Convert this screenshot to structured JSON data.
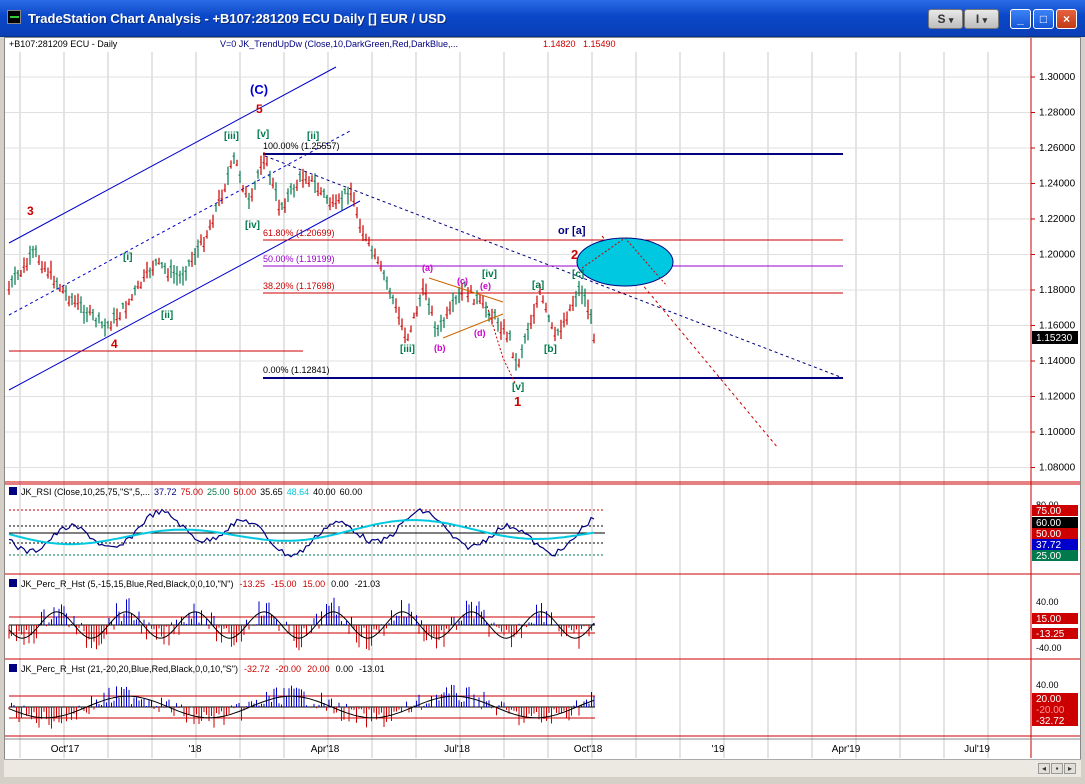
{
  "window": {
    "title": "TradeStation Chart Analysis - +B107:281209 ECU Daily [] EUR / USD",
    "btn_s": "S",
    "btn_i": "I",
    "btn_dropdown": "▾",
    "btn_min": "_",
    "btn_max": "□",
    "btn_close": "×"
  },
  "main_panel": {
    "symbol_label": "+B107:281209 ECU - Daily",
    "indicator_label": "V=0  JK_TrendUpDw (Close,10,DarkGreen,Red,DarkBlue,...",
    "indicator_value1": "1.14820",
    "indicator_value2": "1.15490",
    "price_ticks": [
      "1.30000",
      "1.28000",
      "1.26000",
      "1.24000",
      "1.22000",
      "1.20000",
      "1.18000",
      "1.16000",
      "1.14000",
      "1.12000",
      "1.10000",
      "1.08000"
    ],
    "last_price": "1.15230",
    "fib_labels": [
      "100.00% (1.25557)",
      "61.80% (1.20699)",
      "50.00% (1.19199)",
      "38.20% (1.17698)",
      "0.00% (1.12841)"
    ],
    "wave_labels": {
      "c": "(C)",
      "w5": "5",
      "w3": "3",
      "w4": "4",
      "w1": "1",
      "w2": "2",
      "i": "[i]",
      "ii": "[ii]",
      "iii_top": "[iii]",
      "v_top": "[v]",
      "iv_top": "[iv]",
      "ii_top": "[ii]",
      "iii_low": "[iii]",
      "a": "(a)",
      "b": "(b)",
      "c_small": "(c)",
      "d": "(d)",
      "e": "(e)",
      "iv_mid": "[iv]",
      "v_low": "[v]",
      "a_sq": "[a]",
      "b_sq": "[b]",
      "c_sq": "[c]",
      "or_a": "or [a]"
    }
  },
  "rsi_panel": {
    "label": "JK_RSI (Close,10,25,75,\"S\",5,...",
    "values": [
      "37.72",
      "75.00",
      "25.00",
      "50.00",
      "35.65",
      "48.64",
      "40.00",
      "60.00"
    ],
    "scale_top": "80.00",
    "badges": [
      "75.00",
      "60.00",
      "50.00",
      "37.72",
      "25.00"
    ]
  },
  "perc1_panel": {
    "label": "JK_Perc_R_Hst (5,-15,15,Blue,Red,Black,0,0,10,\"N\")",
    "values": [
      "-13.25",
      "-15.00",
      "15.00",
      "0.00",
      "-21.03"
    ],
    "scale": [
      "40.00",
      "-40.00"
    ],
    "badges": [
      "15.00",
      "-13.25"
    ]
  },
  "perc2_panel": {
    "label": "JK_Perc_R_Hst (21,-20,20,Blue,Red,Black,0,0,10,\"S\")",
    "values": [
      "-32.72",
      "-20.00",
      "20.00",
      "0.00",
      "-13.01"
    ],
    "scale": [
      "40.00"
    ],
    "badges": [
      "20.00",
      "-32.72"
    ],
    "hidden_badge": "-20.00"
  },
  "time_axis": [
    "Oct'17",
    "'18",
    "Apr'18",
    "Jul'18",
    "Oct'18",
    "'19",
    "Apr'19",
    "Jul'19"
  ],
  "colors": {
    "blue": "#0000cc",
    "red": "#cc0000",
    "green": "#007a4d",
    "magenta": "#cc00cc",
    "cyan": "#00c8e0",
    "navy": "#000080"
  }
}
